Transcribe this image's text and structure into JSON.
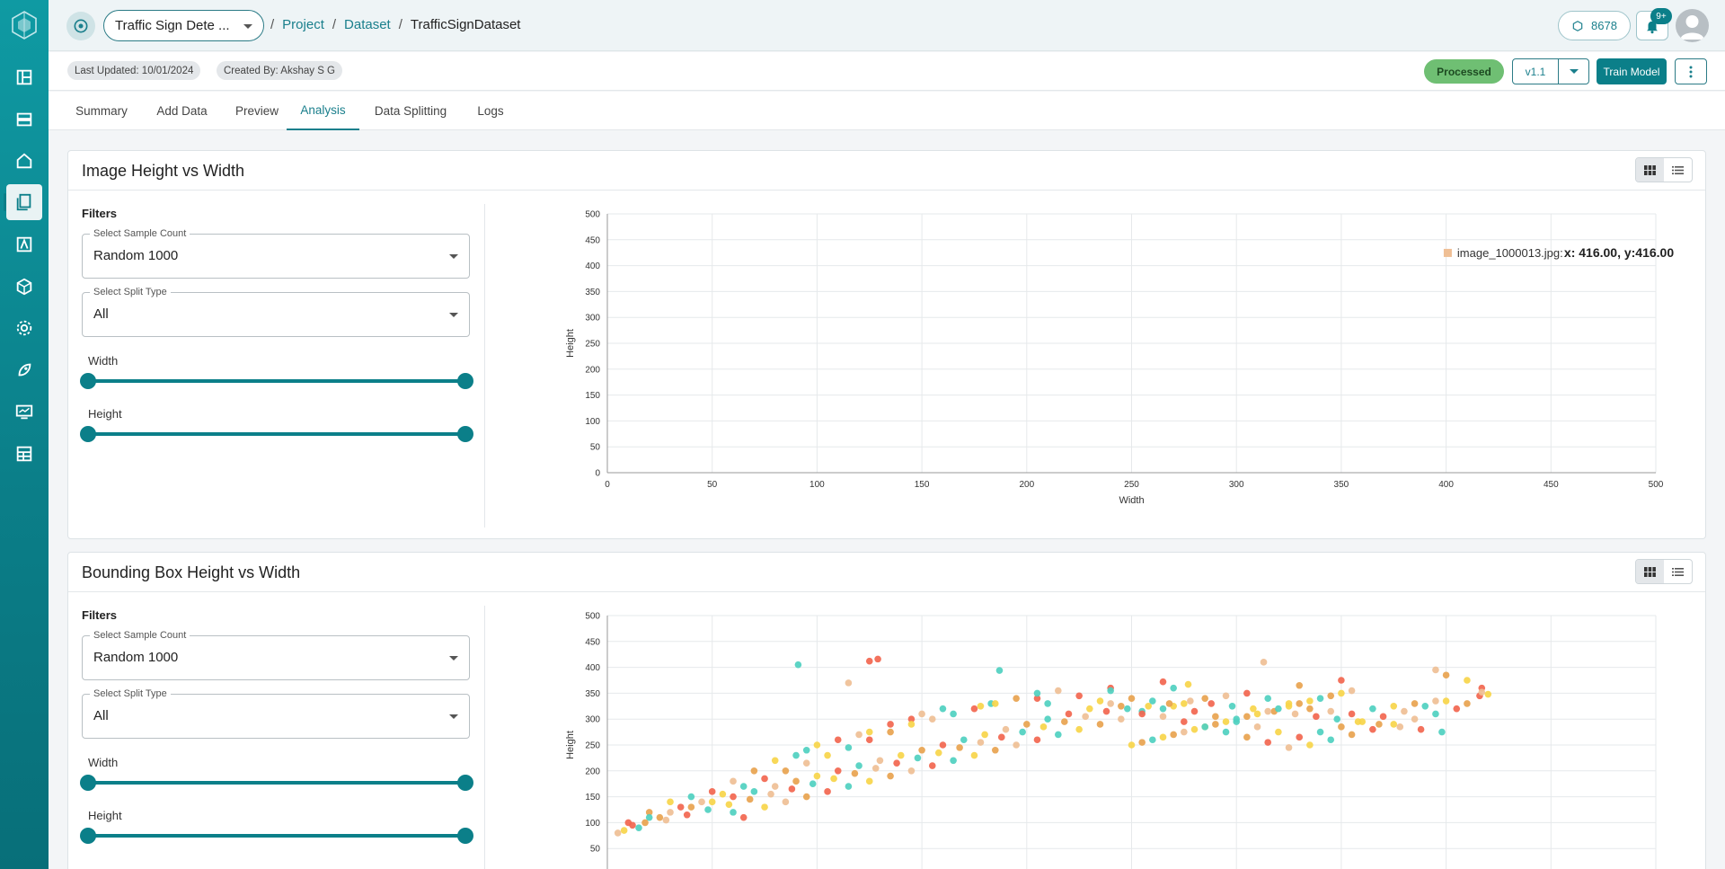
{
  "topbar": {
    "project_name": "Traffic Sign Dete ...",
    "breadcrumb": [
      "Project",
      "Dataset"
    ],
    "current": "TrafficSignDataset",
    "credits": "8678",
    "notif_badge": "9+"
  },
  "meta": {
    "last_updated": "Last Updated: 10/01/2024",
    "created_by": "Created By: Akshay S G",
    "status": "Processed",
    "version": "v1.1",
    "train_label": "Train Model"
  },
  "tabs": [
    "Summary",
    "Add Data",
    "Preview",
    "Analysis",
    "Data Splitting",
    "Logs"
  ],
  "active_tab": "Analysis",
  "panels": [
    {
      "title": "Image Height vs Width",
      "filters_label": "Filters",
      "sample_label": "Select Sample Count",
      "sample_value": "Random 1000",
      "split_label": "Select Split Type",
      "split_value": "All",
      "width_label": "Width",
      "height_label": "Height"
    },
    {
      "title": "Bounding Box Height vs Width",
      "filters_label": "Filters",
      "sample_label": "Select Sample Count",
      "sample_value": "Random 1000",
      "split_label": "Select Split Type",
      "split_value": "All",
      "width_label": "Width",
      "height_label": "Height"
    }
  ],
  "colors": {
    "accent": "#0b7f89",
    "series": [
      "#f2664f",
      "#4fd0c0",
      "#f7d54a",
      "#e8a34f",
      "#efbf95"
    ]
  },
  "chart_data": [
    {
      "type": "scatter",
      "title": "Image Height vs Width",
      "xlabel": "Width",
      "ylabel": "Height",
      "xlim": [
        0,
        500
      ],
      "ylim": [
        0,
        500
      ],
      "xticks": [
        0,
        50,
        100,
        150,
        200,
        250,
        300,
        350,
        400,
        450,
        500
      ],
      "yticks": [
        0,
        50,
        100,
        150,
        200,
        250,
        300,
        350,
        400,
        450,
        500
      ],
      "tooltip": {
        "name": "image_1000013.jpg:",
        "value": "x: 416.00, y:416.00"
      },
      "points": []
    },
    {
      "type": "scatter",
      "title": "Bounding Box Height vs Width",
      "xlabel": "",
      "ylabel": "Height",
      "xlim": [
        0,
        500
      ],
      "ylim": [
        0,
        500
      ],
      "yticks": [
        50,
        100,
        150,
        200,
        250,
        300,
        350,
        400,
        450,
        500
      ],
      "points": [
        [
          91,
          405,
          1
        ],
        [
          125,
          412,
          0
        ],
        [
          129,
          416,
          0
        ],
        [
          115,
          370,
          4
        ],
        [
          187,
          394,
          1
        ],
        [
          313,
          410,
          4
        ],
        [
          265,
          372,
          0
        ],
        [
          395,
          395,
          4
        ],
        [
          400,
          385,
          3
        ],
        [
          410,
          375,
          2
        ],
        [
          417,
          360,
          0
        ],
        [
          416,
          345,
          0
        ],
        [
          417,
          352,
          4
        ],
        [
          420,
          348,
          2
        ],
        [
          350,
          375,
          0
        ],
        [
          330,
          365,
          3
        ],
        [
          277,
          367,
          2
        ],
        [
          270,
          360,
          1
        ],
        [
          240,
          360,
          0
        ],
        [
          240,
          355,
          1
        ],
        [
          210,
          330,
          1
        ],
        [
          205,
          340,
          0
        ],
        [
          183,
          330,
          1
        ],
        [
          150,
          310,
          4
        ],
        [
          135,
          290,
          0
        ],
        [
          120,
          270,
          4
        ],
        [
          100,
          250,
          2
        ],
        [
          95,
          240,
          1
        ],
        [
          160,
          320,
          1
        ],
        [
          178,
          325,
          2
        ],
        [
          145,
          300,
          0
        ],
        [
          125,
          275,
          2
        ],
        [
          110,
          260,
          0
        ],
        [
          90,
          230,
          1
        ],
        [
          80,
          220,
          2
        ],
        [
          70,
          200,
          3
        ],
        [
          60,
          180,
          4
        ],
        [
          50,
          160,
          0
        ],
        [
          40,
          150,
          1
        ],
        [
          30,
          140,
          2
        ],
        [
          20,
          120,
          3
        ],
        [
          10,
          100,
          0
        ],
        [
          5,
          80,
          4
        ],
        [
          15,
          90,
          1
        ],
        [
          25,
          110,
          3
        ],
        [
          35,
          130,
          0
        ],
        [
          45,
          140,
          4
        ],
        [
          55,
          155,
          2
        ],
        [
          65,
          170,
          1
        ],
        [
          75,
          185,
          0
        ],
        [
          85,
          200,
          3
        ],
        [
          95,
          215,
          4
        ],
        [
          105,
          230,
          2
        ],
        [
          115,
          245,
          1
        ],
        [
          125,
          260,
          0
        ],
        [
          135,
          275,
          3
        ],
        [
          145,
          290,
          2
        ],
        [
          155,
          300,
          4
        ],
        [
          165,
          310,
          1
        ],
        [
          175,
          320,
          0
        ],
        [
          185,
          330,
          2
        ],
        [
          195,
          340,
          3
        ],
        [
          205,
          350,
          1
        ],
        [
          215,
          355,
          4
        ],
        [
          225,
          345,
          0
        ],
        [
          235,
          335,
          2
        ],
        [
          245,
          325,
          3
        ],
        [
          255,
          315,
          1
        ],
        [
          265,
          305,
          4
        ],
        [
          275,
          295,
          0
        ],
        [
          285,
          285,
          2
        ],
        [
          295,
          275,
          1
        ],
        [
          305,
          265,
          3
        ],
        [
          315,
          255,
          0
        ],
        [
          325,
          245,
          4
        ],
        [
          335,
          250,
          2
        ],
        [
          345,
          260,
          1
        ],
        [
          355,
          270,
          3
        ],
        [
          365,
          280,
          0
        ],
        [
          375,
          290,
          2
        ],
        [
          385,
          300,
          4
        ],
        [
          395,
          310,
          1
        ],
        [
          405,
          320,
          0
        ],
        [
          410,
          330,
          3
        ],
        [
          400,
          335,
          2
        ],
        [
          390,
          325,
          1
        ],
        [
          380,
          315,
          4
        ],
        [
          370,
          305,
          0
        ],
        [
          360,
          295,
          2
        ],
        [
          350,
          285,
          3
        ],
        [
          340,
          275,
          1
        ],
        [
          330,
          265,
          0
        ],
        [
          320,
          275,
          2
        ],
        [
          310,
          285,
          4
        ],
        [
          300,
          295,
          1
        ],
        [
          290,
          305,
          3
        ],
        [
          280,
          315,
          0
        ],
        [
          270,
          325,
          2
        ],
        [
          260,
          335,
          1
        ],
        [
          250,
          340,
          3
        ],
        [
          240,
          330,
          4
        ],
        [
          230,
          320,
          2
        ],
        [
          220,
          310,
          0
        ],
        [
          210,
          300,
          1
        ],
        [
          200,
          290,
          3
        ],
        [
          190,
          280,
          4
        ],
        [
          180,
          270,
          2
        ],
        [
          170,
          260,
          1
        ],
        [
          160,
          250,
          0
        ],
        [
          150,
          240,
          3
        ],
        [
          140,
          230,
          2
        ],
        [
          130,
          220,
          4
        ],
        [
          120,
          210,
          1
        ],
        [
          110,
          200,
          0
        ],
        [
          100,
          190,
          2
        ],
        [
          90,
          180,
          3
        ],
        [
          80,
          170,
          4
        ],
        [
          70,
          160,
          1
        ],
        [
          60,
          150,
          0
        ],
        [
          50,
          140,
          2
        ],
        [
          40,
          130,
          3
        ],
        [
          30,
          120,
          4
        ],
        [
          20,
          110,
          1
        ],
        [
          12,
          95,
          0
        ],
        [
          8,
          85,
          2
        ],
        [
          18,
          100,
          3
        ],
        [
          28,
          105,
          4
        ],
        [
          38,
          115,
          0
        ],
        [
          48,
          125,
          1
        ],
        [
          58,
          135,
          2
        ],
        [
          68,
          145,
          3
        ],
        [
          78,
          155,
          4
        ],
        [
          88,
          165,
          0
        ],
        [
          98,
          175,
          1
        ],
        [
          108,
          185,
          2
        ],
        [
          118,
          195,
          3
        ],
        [
          128,
          205,
          4
        ],
        [
          138,
          215,
          0
        ],
        [
          148,
          225,
          1
        ],
        [
          158,
          235,
          2
        ],
        [
          168,
          245,
          3
        ],
        [
          178,
          255,
          4
        ],
        [
          188,
          265,
          0
        ],
        [
          198,
          275,
          1
        ],
        [
          208,
          285,
          2
        ],
        [
          218,
          295,
          3
        ],
        [
          228,
          305,
          4
        ],
        [
          238,
          315,
          0
        ],
        [
          248,
          320,
          1
        ],
        [
          258,
          325,
          2
        ],
        [
          268,
          330,
          3
        ],
        [
          278,
          335,
          4
        ],
        [
          288,
          330,
          0
        ],
        [
          298,
          325,
          1
        ],
        [
          308,
          320,
          2
        ],
        [
          318,
          315,
          3
        ],
        [
          328,
          310,
          4
        ],
        [
          338,
          305,
          0
        ],
        [
          348,
          300,
          1
        ],
        [
          358,
          295,
          2
        ],
        [
          368,
          290,
          3
        ],
        [
          378,
          285,
          4
        ],
        [
          388,
          280,
          0
        ],
        [
          398,
          275,
          1
        ],
        [
          60,
          120,
          1
        ],
        [
          65,
          110,
          0
        ],
        [
          75,
          130,
          2
        ],
        [
          85,
          140,
          4
        ],
        [
          95,
          150,
          3
        ],
        [
          105,
          160,
          0
        ],
        [
          115,
          170,
          1
        ],
        [
          125,
          180,
          2
        ],
        [
          135,
          190,
          3
        ],
        [
          145,
          200,
          4
        ],
        [
          155,
          210,
          0
        ],
        [
          165,
          220,
          1
        ],
        [
          175,
          230,
          2
        ],
        [
          185,
          240,
          3
        ],
        [
          195,
          250,
          4
        ],
        [
          205,
          260,
          0
        ],
        [
          215,
          270,
          1
        ],
        [
          225,
          280,
          2
        ],
        [
          235,
          290,
          3
        ],
        [
          245,
          300,
          4
        ],
        [
          255,
          310,
          0
        ],
        [
          265,
          320,
          1
        ],
        [
          275,
          330,
          2
        ],
        [
          285,
          340,
          3
        ],
        [
          295,
          345,
          4
        ],
        [
          305,
          350,
          0
        ],
        [
          315,
          340,
          1
        ],
        [
          325,
          330,
          2
        ],
        [
          335,
          320,
          3
        ],
        [
          345,
          315,
          4
        ],
        [
          355,
          310,
          0
        ],
        [
          365,
          320,
          1
        ],
        [
          375,
          325,
          2
        ],
        [
          385,
          330,
          3
        ],
        [
          395,
          335,
          4
        ],
        [
          250,
          250,
          2
        ],
        [
          255,
          255,
          3
        ],
        [
          260,
          260,
          1
        ],
        [
          265,
          265,
          2
        ],
        [
          270,
          270,
          3
        ],
        [
          275,
          275,
          4
        ],
        [
          280,
          280,
          2
        ],
        [
          285,
          285,
          1
        ],
        [
          290,
          290,
          3
        ],
        [
          295,
          295,
          2
        ],
        [
          300,
          300,
          1
        ],
        [
          305,
          305,
          3
        ],
        [
          310,
          310,
          2
        ],
        [
          315,
          315,
          4
        ],
        [
          320,
          320,
          1
        ],
        [
          325,
          325,
          2
        ],
        [
          330,
          330,
          3
        ],
        [
          335,
          335,
          2
        ],
        [
          340,
          340,
          1
        ],
        [
          345,
          345,
          3
        ],
        [
          350,
          350,
          2
        ],
        [
          355,
          355,
          4
        ]
      ]
    }
  ]
}
